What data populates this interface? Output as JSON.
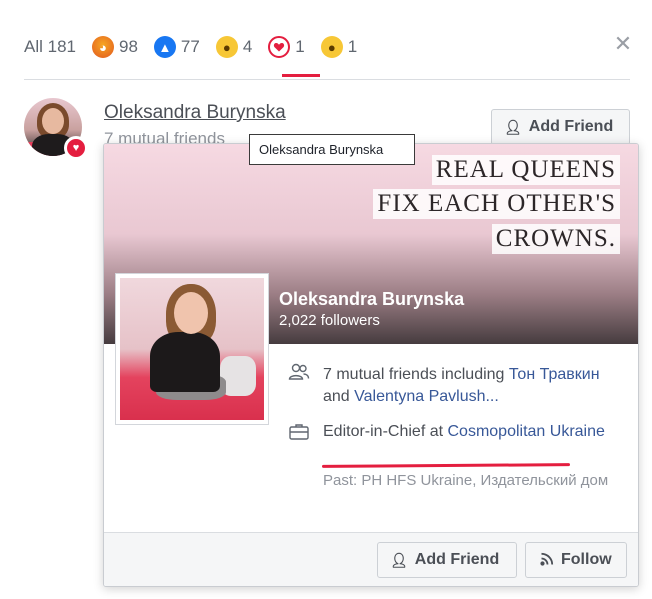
{
  "reactions_bar": {
    "all_label": "All 181",
    "tabs": [
      {
        "icon": "angry-icon",
        "count": "98"
      },
      {
        "icon": "like-icon",
        "count": "77"
      },
      {
        "icon": "wow-icon",
        "count": "4"
      },
      {
        "icon": "love-icon",
        "count": "1",
        "active": true
      },
      {
        "icon": "haha-icon",
        "count": "1"
      }
    ],
    "close_symbol": "✕",
    "active_color": "#e41e3f"
  },
  "list_row": {
    "name": "Oleksandra Burynska",
    "mutual": "7 mutual friends",
    "add_friend_label": "Add Friend"
  },
  "tooltip": {
    "text": "Oleksandra Burynska"
  },
  "hover_card": {
    "cover_quote": [
      "REAL QUEENS",
      "FIX EACH OTHER'S",
      "CROWNS."
    ],
    "name": "Oleksandra Burynska",
    "followers": "2,022 followers",
    "mutual": {
      "prefix": "7 mutual friends including ",
      "friend1": "Тон Травкин",
      "joiner": " and ",
      "friend2": "Valentyna Pavlush..."
    },
    "work": {
      "prefix": "Editor-in-Chief at ",
      "company": "Cosmopolitan Ukraine"
    },
    "past": "Past: PH HFS Ukraine, Издательский дом",
    "add_friend_label": "Add Friend",
    "follow_label": "Follow"
  }
}
